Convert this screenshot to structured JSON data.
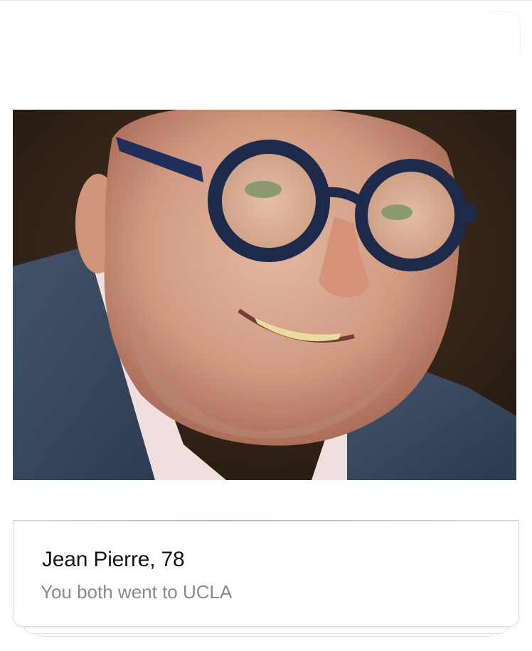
{
  "profile": {
    "name": "Jean Pierre",
    "age": "78",
    "name_age": "Jean Pierre, 78",
    "common_ground": "You both went to UCLA",
    "photo_subject": "smiling older man with round navy glasses"
  },
  "colors": {
    "background": "#ffffff",
    "name_text": "#141414",
    "subtitle_text": "#8a8a8a",
    "card_border": "#dcdcdc",
    "photo_backdrop": "#3a2a1d",
    "glasses": "#1d2a4a"
  }
}
